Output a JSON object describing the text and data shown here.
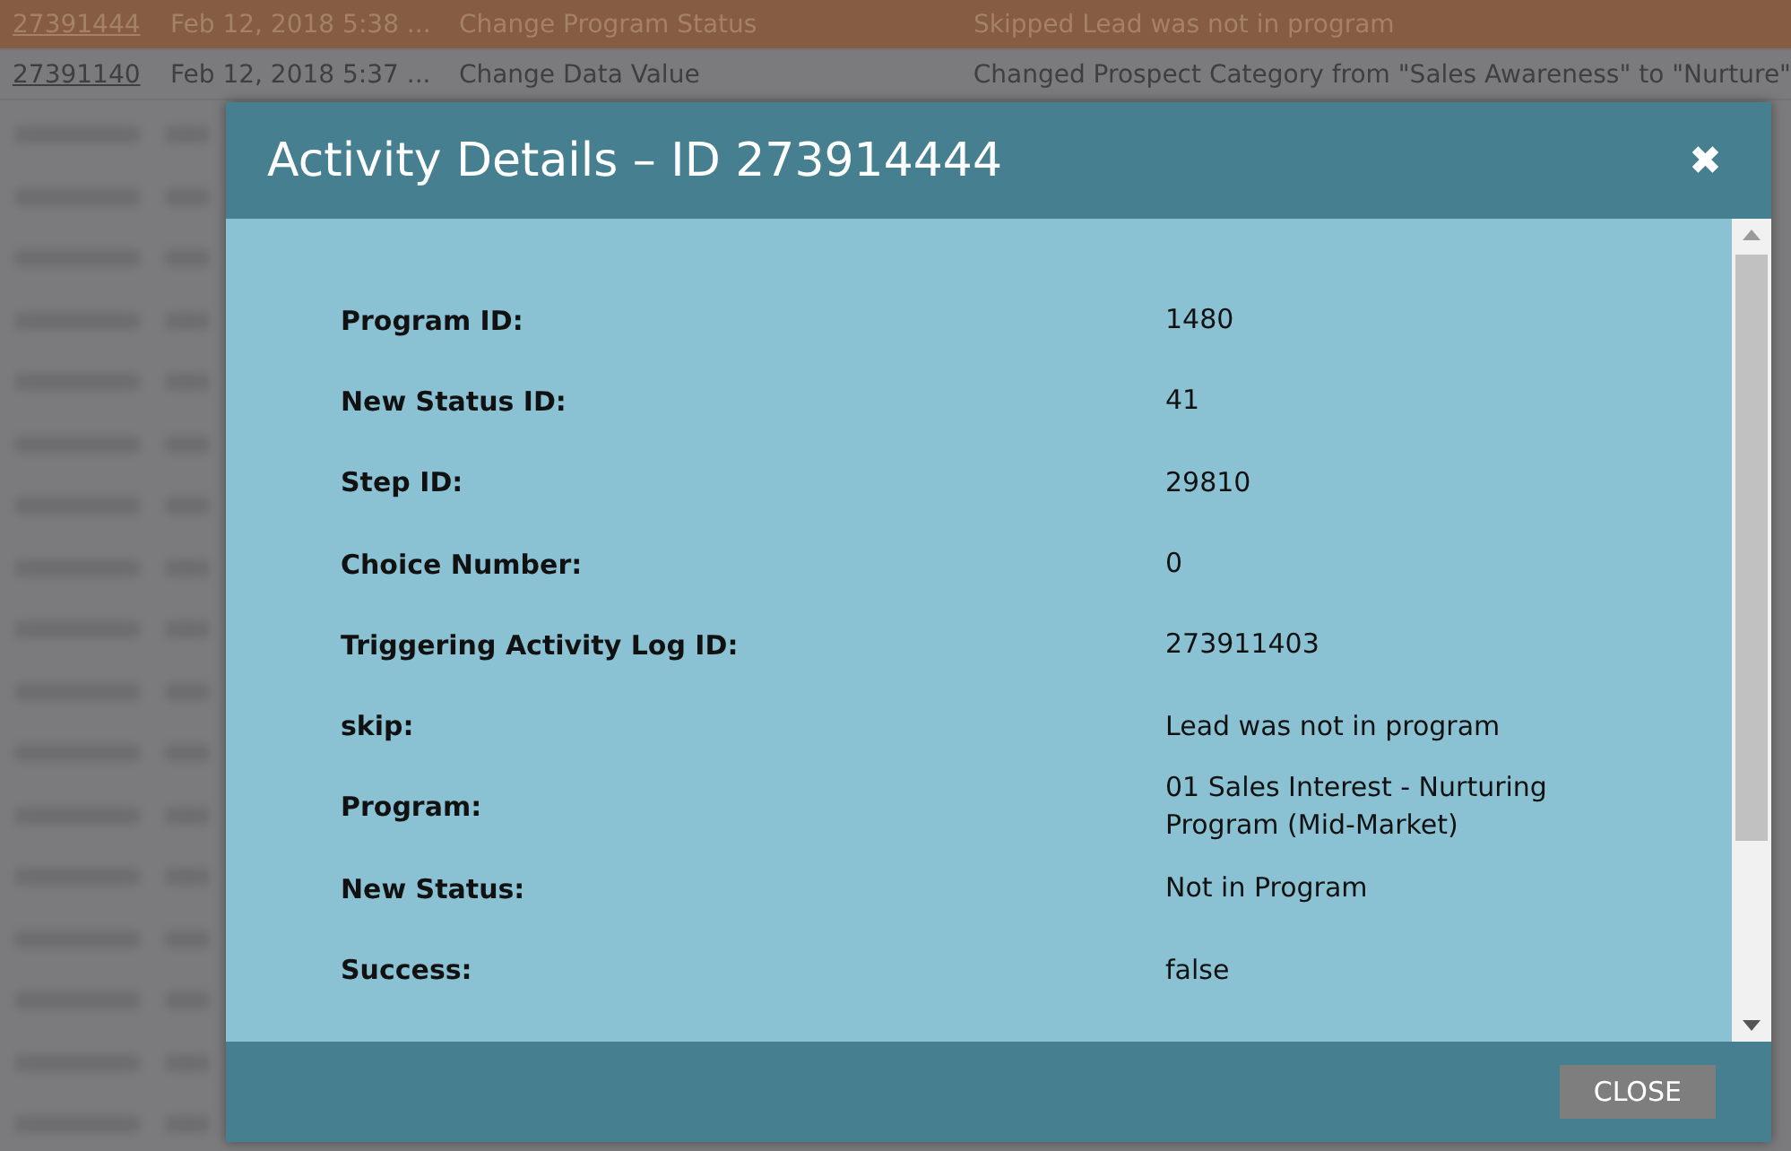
{
  "background_rows": [
    {
      "id": "27391444",
      "date": "Feb 12, 2018 5:38 ...",
      "activity": "Change Program Status",
      "detail": "Skipped Lead was not in program",
      "selected": true
    },
    {
      "id": "27391140",
      "date": "Feb 12, 2018 5:37 ...",
      "activity": "Change Data Value",
      "detail": "Changed Prospect Category from \"Sales Awareness\" to \"Nurture\"",
      "selected": false
    }
  ],
  "dialog": {
    "title": "Activity Details – ID 273914444",
    "close_icon": "✖",
    "fields": [
      {
        "label": "Program ID:",
        "value": "1480"
      },
      {
        "label": "New Status ID:",
        "value": "41"
      },
      {
        "label": "Step ID:",
        "value": "29810"
      },
      {
        "label": "Choice Number:",
        "value": "0"
      },
      {
        "label": "Triggering Activity Log ID:",
        "value": "273911403"
      },
      {
        "label": "skip:",
        "value": "Lead was not in program"
      },
      {
        "label": "Program:",
        "value": "01 Sales Interest - Nurturing Program (Mid-Market)"
      },
      {
        "label": "New Status:",
        "value": "Not in Program"
      },
      {
        "label": "Success:",
        "value": "false"
      }
    ],
    "close_button": "CLOSE"
  }
}
